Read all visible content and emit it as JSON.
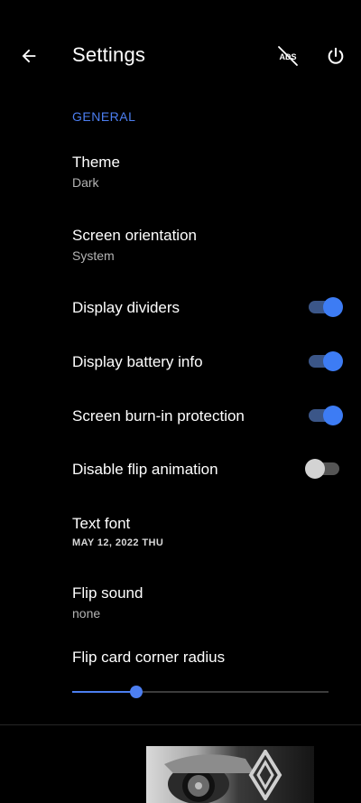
{
  "header": {
    "title": "Settings",
    "ads_icon_text": "ADS"
  },
  "sections": [
    {
      "header": "GENERAL"
    }
  ],
  "settings": {
    "theme": {
      "label": "Theme",
      "value": "Dark"
    },
    "screen_orientation": {
      "label": "Screen orientation",
      "value": "System"
    },
    "display_dividers": {
      "label": "Display dividers",
      "enabled": true
    },
    "display_battery_info": {
      "label": "Display battery info",
      "enabled": true
    },
    "screen_burn_in_protection": {
      "label": "Screen burn-in protection",
      "enabled": true
    },
    "disable_flip_animation": {
      "label": "Disable flip animation",
      "enabled": false
    },
    "text_font": {
      "label": "Text font",
      "value": "MAY 12, 2022 THU"
    },
    "flip_sound": {
      "label": "Flip sound",
      "value": "none"
    },
    "flip_card_corner_radius": {
      "label": "Flip card corner radius",
      "level": 0.25
    }
  },
  "colors": {
    "accent": "#4c7ef0",
    "switch_on_thumb": "#3d7cf4",
    "switch_on_track": "#3b5688",
    "switch_off_thumb": "#d3d3d3",
    "switch_off_track": "#555555",
    "background": "#000000",
    "secondary_text": "#b3b3b3"
  },
  "icons": {
    "back": "arrow-left-icon",
    "ads": "remove-ads-icon",
    "power": "power-icon"
  }
}
